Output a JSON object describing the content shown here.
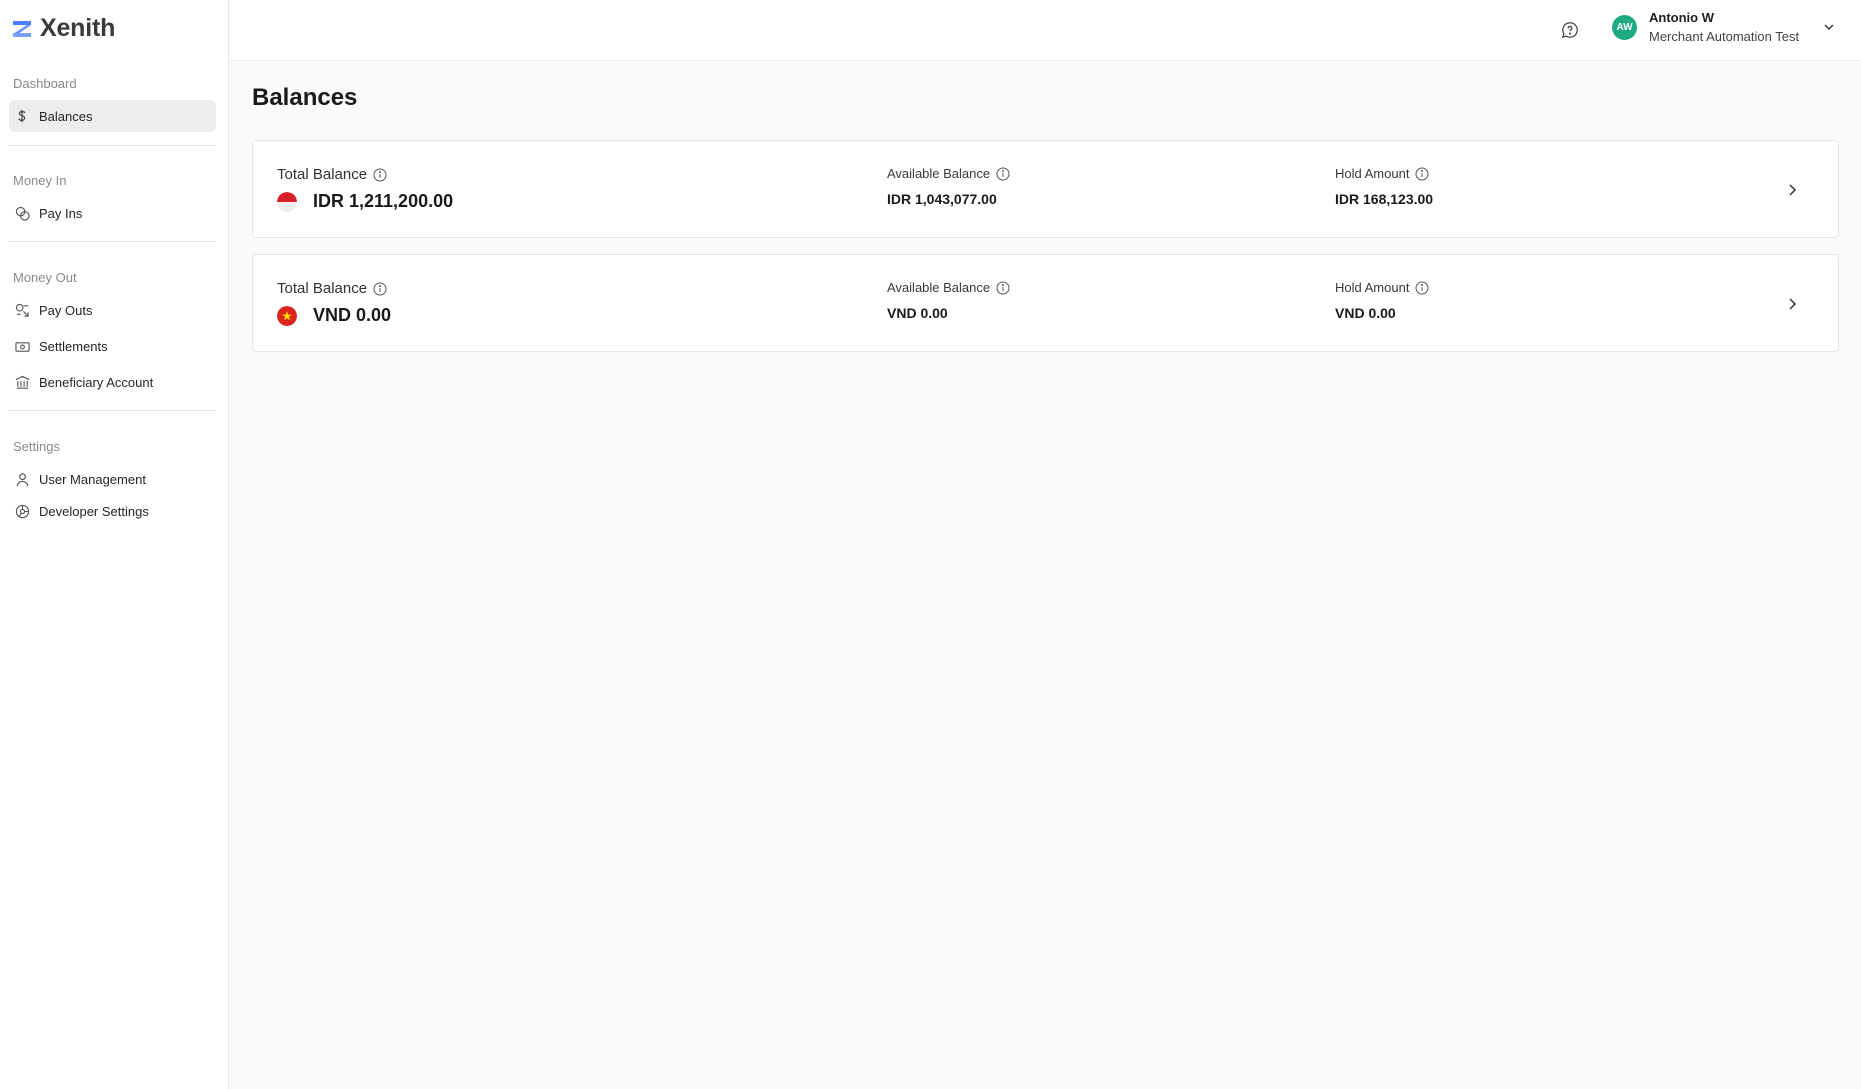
{
  "app": {
    "name": "Xenith"
  },
  "sidebar": {
    "groups": [
      {
        "label": "Dashboard",
        "items": [
          {
            "label": "Balances",
            "icon": "dollar-icon",
            "active": true
          }
        ]
      },
      {
        "label": "Money In",
        "items": [
          {
            "label": "Pay Ins",
            "icon": "coins-icon"
          }
        ]
      },
      {
        "label": "Money Out",
        "items": [
          {
            "label": "Pay Outs",
            "icon": "payout-icon"
          },
          {
            "label": "Settlements",
            "icon": "banknote-icon"
          },
          {
            "label": "Beneficiary Account",
            "icon": "bank-icon"
          }
        ]
      },
      {
        "label": "Settings",
        "items": [
          {
            "label": "User Management",
            "icon": "user-icon"
          },
          {
            "label": "Developer Settings",
            "icon": "settings-icon"
          }
        ]
      }
    ]
  },
  "topbar": {
    "user": {
      "initials": "AW",
      "name": "Antonio W",
      "org": "Merchant Automation Test"
    },
    "avatar_color": "#1faa83"
  },
  "main": {
    "title": "Balances",
    "balances": [
      {
        "currency_flag": "indonesia-flag-icon",
        "total_label": "Total Balance",
        "total": "IDR 1,211,200.00",
        "available_label": "Available Balance",
        "available": "IDR 1,043,077.00",
        "hold_label": "Hold Amount",
        "hold": "IDR 168,123.00"
      },
      {
        "currency_flag": "vietnam-flag-icon",
        "total_label": "Total Balance",
        "total": "VND 0.00",
        "available_label": "Available Balance",
        "available": "VND 0.00",
        "hold_label": "Hold Amount",
        "hold": "VND 0.00"
      }
    ]
  }
}
